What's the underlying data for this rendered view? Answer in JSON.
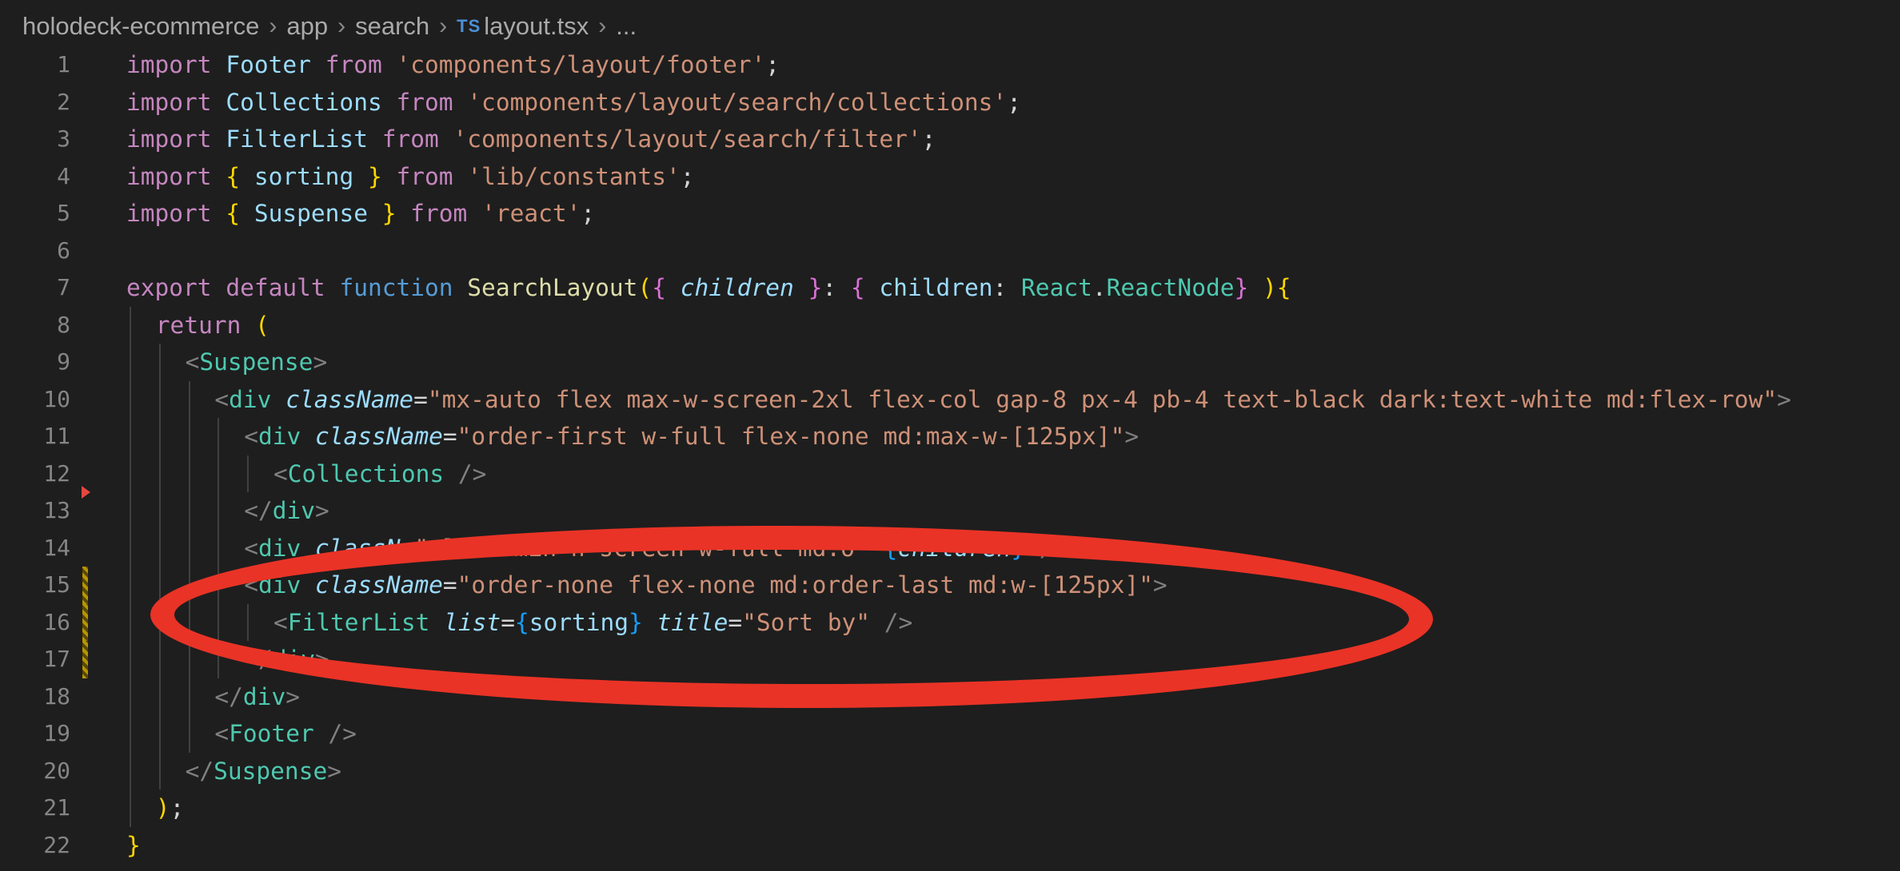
{
  "breadcrumb": {
    "items": [
      "holodeck-ecommerce",
      "app",
      "search"
    ],
    "file_icon": "TS",
    "file": "layout.tsx",
    "trailing": "..."
  },
  "editor": {
    "line_numbers": [
      "1",
      "2",
      "3",
      "4",
      "5",
      "6",
      "7",
      "8",
      "9",
      "10",
      "11",
      "12",
      "13",
      "14",
      "15",
      "16",
      "17",
      "18",
      "19",
      "20",
      "21",
      "22"
    ],
    "lines": [
      [
        "import",
        "Footer",
        "from",
        "'components/layout/footer'",
        ";"
      ],
      [
        "import",
        "Collections",
        "from",
        "'components/layout/search/collections'",
        ";"
      ],
      [
        "import",
        "FilterList",
        "from",
        "'components/layout/search/filter'",
        ";"
      ],
      [
        "import",
        "{",
        "sorting",
        "}",
        "from",
        "'lib/constants'",
        ";"
      ],
      [
        "import",
        "{",
        "Suspense",
        "}",
        "from",
        "'react'",
        ";"
      ],
      [],
      [
        "export",
        "default",
        "function",
        "SearchLayout",
        "(",
        "{",
        "children",
        "}",
        ":",
        "{",
        "children",
        ":",
        "React",
        ".",
        "ReactNode",
        "}",
        ")",
        "{"
      ],
      [
        "return",
        "("
      ],
      [
        "<",
        "Suspense",
        ">"
      ],
      [
        "<",
        "div",
        "className",
        "=",
        "\"mx-auto flex max-w-screen-2xl flex-col gap-8 px-4 pb-4 text-black dark:text-white md:flex-row\"",
        ">"
      ],
      [
        "<",
        "div",
        "className",
        "=",
        "\"order-first w-full flex-none md:max-w-[125px]\"",
        ">"
      ],
      [
        "<",
        "Collections",
        "/>"
      ],
      [
        "</",
        "div",
        ">"
      ],
      [
        "<",
        "div",
        "classN",
        "\" last min-h-screen w-full md:o",
        "\"",
        "{",
        "children",
        "}",
        "</",
        "div",
        ">"
      ],
      [
        "<",
        "div",
        "className",
        "=",
        "\"order-none flex-none md:order-last md:w-[125px]\"",
        ">"
      ],
      [
        "<",
        "FilterList",
        "list",
        "=",
        "{",
        "sorting",
        "}",
        "title",
        "=",
        "\"Sort by\"",
        "/>"
      ],
      [
        "</",
        "div",
        ">"
      ],
      [
        "</",
        "div",
        ">"
      ],
      [
        "<",
        "Footer",
        "/>"
      ],
      [
        "</",
        "Suspense",
        ">"
      ],
      [
        ")",
        ";"
      ],
      [
        "}"
      ]
    ]
  },
  "colors": {
    "background": "#1e1e1e",
    "annotation_red": "#e83326",
    "keyword": "#c586c0",
    "string": "#ce9178",
    "function": "#dcdcaa",
    "tag": "#4ec9b0"
  }
}
